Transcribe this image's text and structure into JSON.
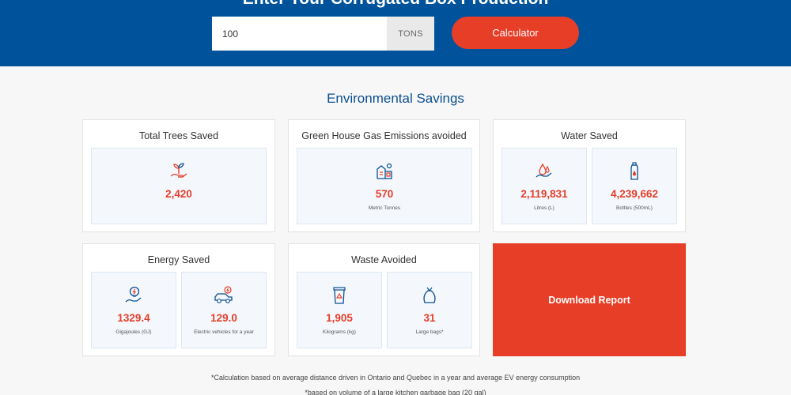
{
  "banner": {
    "title": "Enter Your Corrugated Box Production",
    "quantity_value": "100",
    "unit": "TONS",
    "calc_button": "Calculator"
  },
  "section_title": "Environmental Savings",
  "cards": {
    "trees": {
      "title": "Total Trees Saved",
      "value": "2,420",
      "unit": ""
    },
    "ghg": {
      "title": "Green House Gas Emissions avoided",
      "value": "570",
      "unit": "Metric Tonnes"
    },
    "water": {
      "title": "Water Saved",
      "litres_value": "2,119,831",
      "litres_unit": "Litres (L)",
      "bottles_value": "4,239,662",
      "bottles_unit": "Bottles (500mL)"
    },
    "energy": {
      "title": "Energy Saved",
      "gj_value": "1329.4",
      "gj_unit": "Gigajoules (GJ)",
      "ev_value": "129.0",
      "ev_unit": "Electric vehicles for a year"
    },
    "waste": {
      "title": "Waste Avoided",
      "kg_value": "1,905",
      "kg_unit": "Kilograms (kg)",
      "bags_value": "31",
      "bags_unit": "Large bags*"
    }
  },
  "download_button": "Download Report",
  "notes": {
    "ev_note": "*Calculation based on average distance driven in Ontario and Quebec in a year and average EV energy consumption",
    "bag_note": "*based on volume of a large kitchen garbage bag (20 gal)"
  },
  "colors": {
    "brand_blue": "#00539b",
    "accent_red": "#e73e28",
    "heading_blue": "#0b4f8f"
  }
}
